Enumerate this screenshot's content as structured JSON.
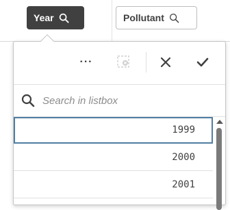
{
  "filters": {
    "year": {
      "label": "Year",
      "icon": "search-icon",
      "active": true
    },
    "pollutant": {
      "label": "Pollutant",
      "icon": "search-icon",
      "active": false
    }
  },
  "toolbar": {
    "more": "···",
    "clear_icon": "clear-selections-icon",
    "cancel_icon": "close-icon",
    "confirm_icon": "checkmark-icon"
  },
  "search": {
    "placeholder": "Search in listbox",
    "value": ""
  },
  "listbox": {
    "items": [
      "1999",
      "2000",
      "2001"
    ],
    "focused_index": 0
  },
  "colors": {
    "chip_active_bg": "#404040",
    "focus_border": "#4f7ea3",
    "text": "#404040"
  }
}
